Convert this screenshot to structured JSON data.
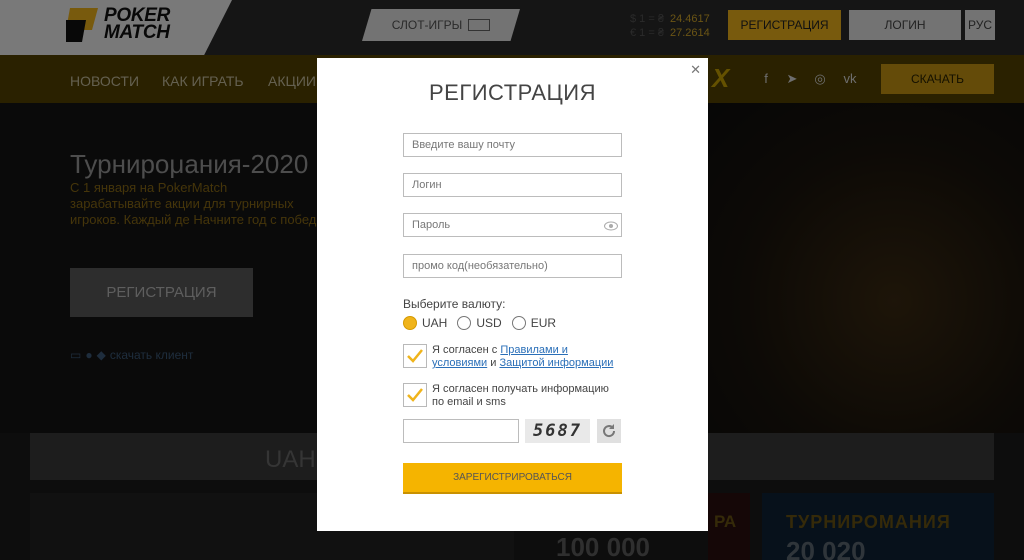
{
  "header": {
    "logo_line1": "POKER",
    "logo_line2": "MATCH",
    "slots_label": "СЛОТ-ИГРЫ",
    "rates": [
      {
        "label": "$ 1 = ₴",
        "value": "24.4617"
      },
      {
        "label": "€ 1 = ₴",
        "value": "27.2614"
      }
    ],
    "register_label": "РЕГИСТРАЦИЯ",
    "login_label": "ЛОГИН",
    "lang_label": "РУС"
  },
  "nav": {
    "items": [
      "НОВОСТИ",
      "КАК ИГРАТЬ",
      "АКЦИИ"
    ],
    "download_label": "СКАЧАТЬ",
    "social_icons": [
      "facebook-icon",
      "telegram-icon",
      "instagram-icon",
      "vk-icon"
    ]
  },
  "hero": {
    "title": "Турнирομания-2020",
    "text": "С 1 января на PokerMatch зарабатывайте акции для турнирных игроков. Каждый де Начните год с побед!",
    "register_label": "РЕГИСТРАЦИЯ",
    "client_link": "скачать клиент"
  },
  "lower": {
    "uah_text": "UAH",
    "amount": "100 000",
    "mid_promo": "РА",
    "right_title": "ТУРНИРОМАНИЯ",
    "right_number": "20 020"
  },
  "modal": {
    "title": "РЕГИСТРАЦИЯ",
    "email_placeholder": "Введите вашу почту",
    "login_placeholder": "Логин",
    "password_placeholder": "Пароль",
    "promo_placeholder": "промо код(необязательно)",
    "currency_label": "Выберите валюту:",
    "currencies": [
      {
        "code": "UAH",
        "selected": true
      },
      {
        "code": "USD",
        "selected": false
      },
      {
        "code": "EUR",
        "selected": false
      }
    ],
    "terms_prefix": "Я согласен с ",
    "terms_link": "Правилами и условиями",
    "terms_and": " и ",
    "privacy_link": "Защитой информации",
    "newsletter_text": "Я согласен получать информацию по email и sms",
    "captcha_code": "5687",
    "submit_label": "ЗАРЕГИСТРИРОВАТЬСЯ"
  },
  "colors": {
    "accent": "#f0b41b",
    "link": "#2a6fb8"
  }
}
